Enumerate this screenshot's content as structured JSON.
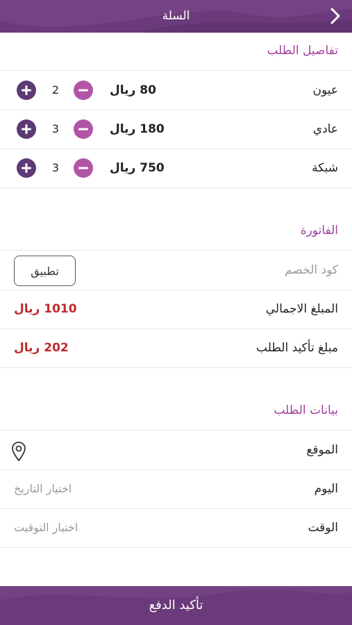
{
  "header": {
    "title": "السلة"
  },
  "order_details": {
    "title": "تفاصيل الطلب",
    "items": [
      {
        "name": "عيون",
        "price": "80 ريال",
        "qty": "2"
      },
      {
        "name": "عادي",
        "price": "180 ريال",
        "qty": "3"
      },
      {
        "name": "شبكة",
        "price": "750 ريال",
        "qty": "3"
      }
    ]
  },
  "invoice": {
    "title": "الفاتورة",
    "discount_placeholder": "كود الخصم",
    "apply_label": "تطبيق",
    "total_label": "المبلغ الاجمالي",
    "total_value": "1010 ريال",
    "confirm_label": "مبلغ تأكيد الطلب",
    "confirm_value": "202 ريال"
  },
  "order_data": {
    "title": "بيانات الطلب",
    "location_label": "الموقع",
    "day_label": "اليوم",
    "day_hint": "اختيار التاريخ",
    "time_label": "الوقت",
    "time_hint": "اختيار التوقيت"
  },
  "footer": {
    "confirm_payment": "تأكيد الدفع"
  },
  "colors": {
    "primary": "#6b3a7a",
    "accent": "#a1409f",
    "amount": "#c0292c"
  }
}
